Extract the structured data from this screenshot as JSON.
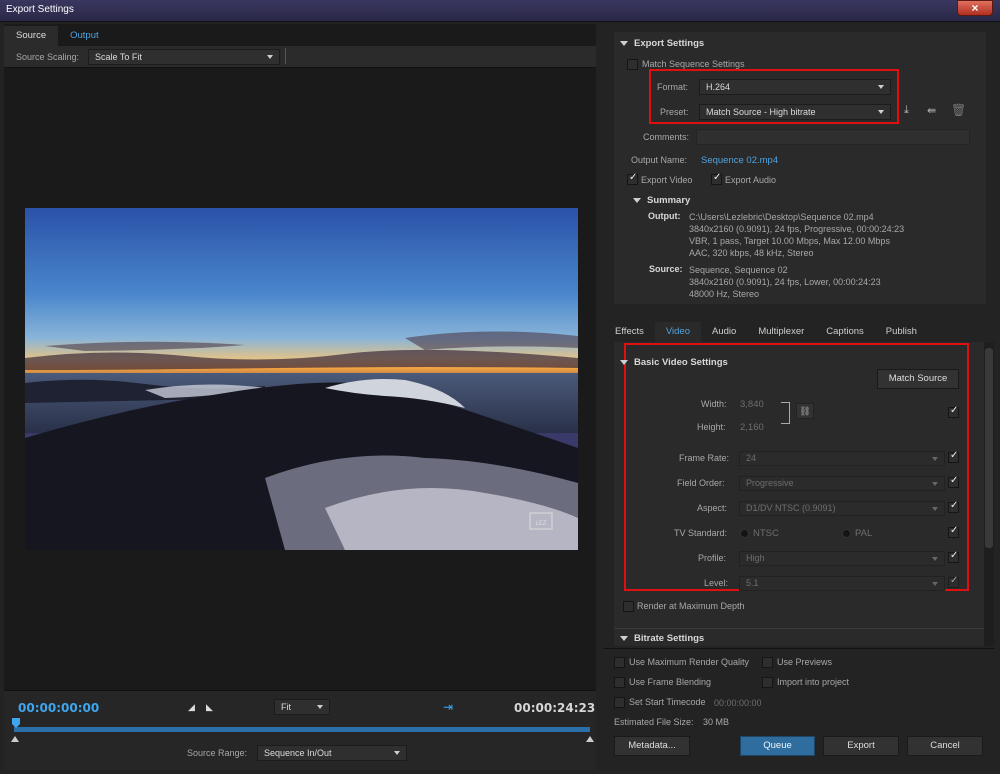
{
  "window": {
    "title": "Export Settings",
    "close_label": "×"
  },
  "left": {
    "tabs": [
      {
        "label": "Source"
      },
      {
        "label": "Output"
      }
    ],
    "source_scaling": {
      "label": "Source Scaling:",
      "value": "Scale To Fit"
    },
    "preview": {
      "watermark": "LEZ"
    },
    "timeline": {
      "current_time": "00:00:00:00",
      "zoom": "Fit",
      "end_time": "00:00:24:23",
      "source_range_label": "Source Range:",
      "source_range_value": "Sequence In/Out"
    }
  },
  "export_settings": {
    "header": "Export Settings",
    "match_sequence": "Match Sequence Settings",
    "format_label": "Format:",
    "format_value": "H.264",
    "preset_label": "Preset:",
    "preset_value": "Match Source - High bitrate",
    "comments_label": "Comments:",
    "output_name_label": "Output Name:",
    "output_name_value": "Sequence 02.mp4",
    "export_video": "Export Video",
    "export_audio": "Export Audio",
    "summary_header": "Summary",
    "output_label": "Output:",
    "output_lines": [
      "C:\\Users\\Lezlebric\\Desktop\\Sequence 02.mp4",
      "3840x2160 (0.9091), 24 fps, Progressive, 00:00:24:23",
      "VBR, 1 pass, Target 10.00 Mbps, Max 12.00 Mbps",
      "AAC, 320 kbps, 48 kHz, Stereo"
    ],
    "source_label": "Source:",
    "source_lines": [
      "Sequence, Sequence 02",
      "3840x2160 (0.9091), 24 fps, Lower, 00:00:24:23",
      "48000 Hz, Stereo"
    ]
  },
  "tabs2": [
    {
      "label": "Effects"
    },
    {
      "label": "Video"
    },
    {
      "label": "Audio"
    },
    {
      "label": "Multiplexer"
    },
    {
      "label": "Captions"
    },
    {
      "label": "Publish"
    }
  ],
  "video": {
    "header": "Basic Video Settings",
    "match_source": "Match Source",
    "width_label": "Width:",
    "width_value": "3,840",
    "height_label": "Height:",
    "height_value": "2,160",
    "frame_rate_label": "Frame Rate:",
    "frame_rate_value": "24",
    "field_order_label": "Field Order:",
    "field_order_value": "Progressive",
    "aspect_label": "Aspect:",
    "aspect_value": "D1/DV NTSC (0.9091)",
    "tv_standard_label": "TV Standard:",
    "ntsc": "NTSC",
    "pal": "PAL",
    "profile_label": "Profile:",
    "profile_value": "High",
    "level_label": "Level:",
    "level_value": "5.1",
    "render_max_depth": "Render at Maximum Depth",
    "bitrate_header": "Bitrate Settings"
  },
  "footer": {
    "use_max_render": "Use Maximum Render Quality",
    "use_previews": "Use Previews",
    "use_frame_blending": "Use Frame Blending",
    "import_into_project": "Import into project",
    "set_start_timecode": "Set Start Timecode",
    "start_timecode_value": "00:00:00:00",
    "estimated_size_label": "Estimated File Size:",
    "estimated_size_value": "30 MB",
    "metadata": "Metadata...",
    "queue": "Queue",
    "export": "Export",
    "cancel": "Cancel"
  }
}
